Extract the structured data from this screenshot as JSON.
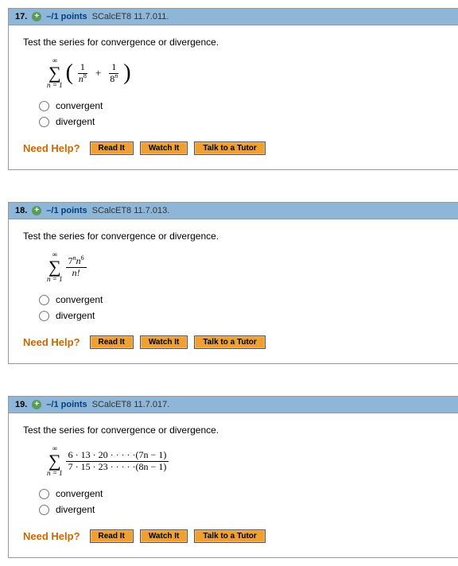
{
  "questions": [
    {
      "num": "17.",
      "points": "–/1 points",
      "source": "SCalcET8 11.7.011.",
      "prompt": "Test the series for convergence or divergence.",
      "sigma_top": "∞",
      "sigma_bottom": "n = 1",
      "frac1_num": "1",
      "frac1_den_base": "n",
      "frac1_den_exp": "8",
      "plus": "+",
      "frac2_num": "1",
      "frac2_den_base": "8",
      "frac2_den_exp": "n",
      "opt1": "convergent",
      "opt2": "divergent"
    },
    {
      "num": "18.",
      "points": "–/1 points",
      "source": "SCalcET8 11.7.013.",
      "prompt": "Test the series for convergence or divergence.",
      "sigma_top": "∞",
      "sigma_bottom": "n = 1",
      "fr_num_a": "7",
      "fr_num_aexp": "n",
      "fr_num_b": "n",
      "fr_num_bexp": "6",
      "fr_den": "n!",
      "opt1": "convergent",
      "opt2": "divergent"
    },
    {
      "num": "19.",
      "points": "–/1 points",
      "source": "SCalcET8 11.7.017.",
      "prompt": "Test the series for convergence or divergence.",
      "sigma_top": "∞",
      "sigma_bottom": "n = 1",
      "fr_num": "6 · 13 · 20 · · · · ·(7n − 1)",
      "fr_den": "7 · 15 · 23 · · · · ·(8n − 1)",
      "opt1": "convergent",
      "opt2": "divergent"
    }
  ],
  "help": {
    "label": "Need Help?",
    "read": "Read It",
    "watch": "Watch It",
    "tutor": "Talk to a Tutor"
  }
}
